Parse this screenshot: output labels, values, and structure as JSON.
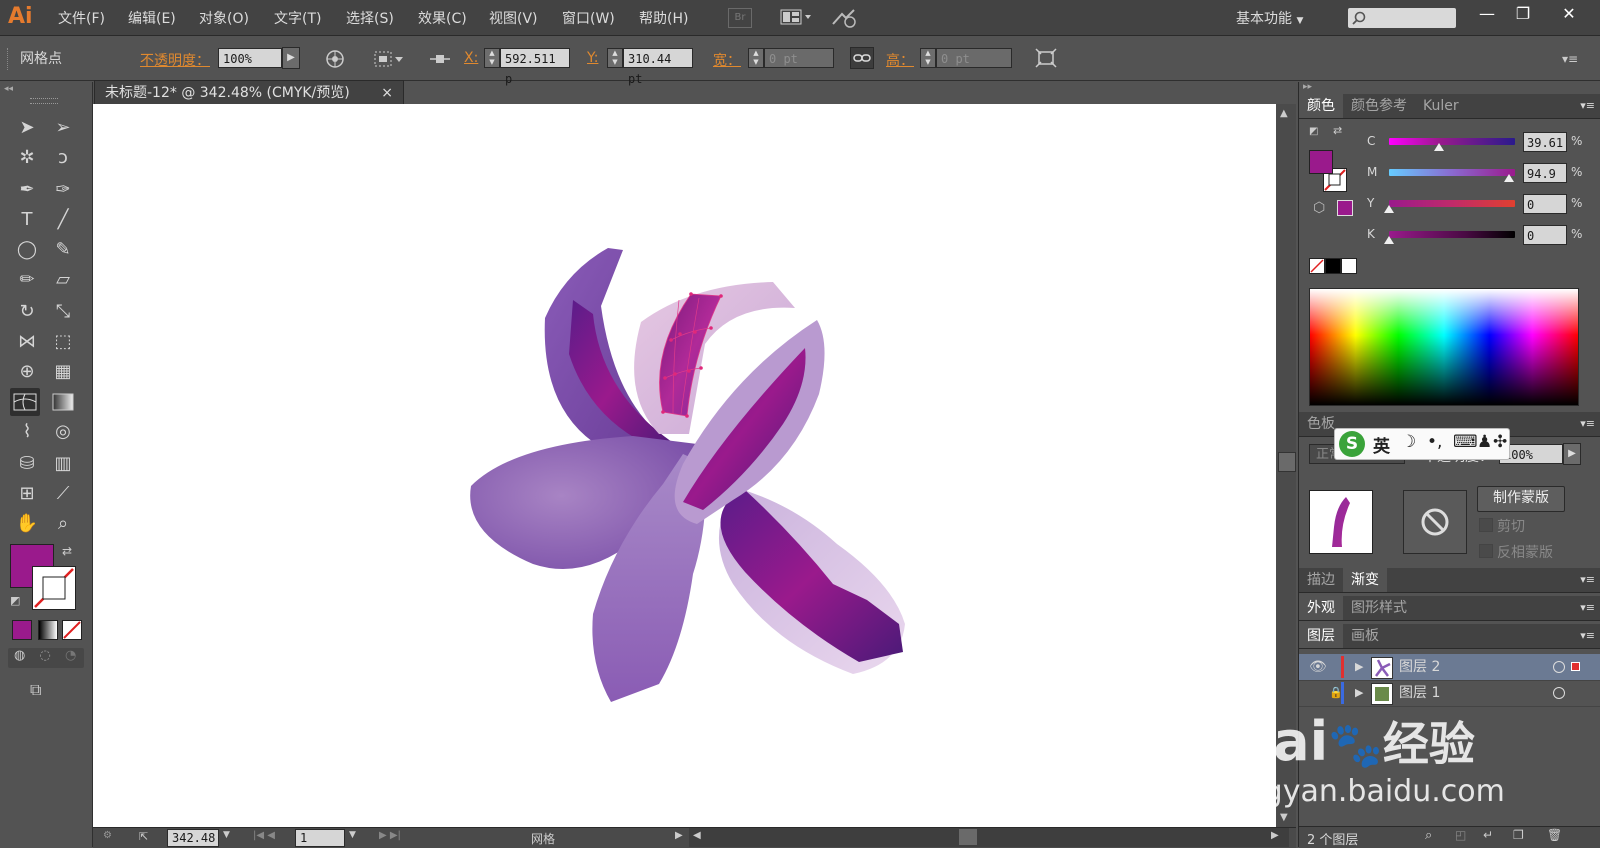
{
  "app": {
    "logo": "Ai"
  },
  "menu": [
    "文件(F)",
    "编辑(E)",
    "对象(O)",
    "文字(T)",
    "选择(S)",
    "效果(C)",
    "视图(V)",
    "窗口(W)",
    "帮助(H)"
  ],
  "bridge_label": "Br",
  "workspace_label": "基本功能",
  "window_controls": {
    "minimize": "—",
    "restore": "❐",
    "close": "✕"
  },
  "control_bar": {
    "selection_type": "网格点",
    "opacity_label": "不透明度：",
    "opacity_value": "100%",
    "x_label": "X:",
    "x_value": "592.511 p",
    "y_label": "Y:",
    "y_value": "310.44 pt",
    "width_label": "宽：",
    "width_value": "0 pt",
    "height_label": "高：",
    "height_value": "0 pt"
  },
  "document": {
    "tab_title": "未标题-12* @ 342.48% (CMYK/预览)",
    "tab_close": "×"
  },
  "status_bar": {
    "zoom": "342.48",
    "artboard": "1",
    "tool_name": "网格"
  },
  "color_panel": {
    "tabs": [
      "颜色",
      "颜色参考",
      "Kuler"
    ],
    "channels": [
      {
        "label": "C",
        "value": "39.61",
        "level": 0.396
      },
      {
        "label": "M",
        "value": "94.9",
        "level": 0.949
      },
      {
        "label": "Y",
        "value": "0",
        "level": 0
      },
      {
        "label": "K",
        "value": "0",
        "level": 0
      }
    ],
    "unit": "%",
    "fill_color": "#9a1a8c"
  },
  "transparency_panel": {
    "tabs_partial": "色板",
    "blend_mode": "正常",
    "opacity_label": "不透明度：",
    "opacity_value": "100%",
    "make_mask": "制作蒙版",
    "clip": "剪切",
    "invert_mask": "反相蒙版"
  },
  "ime_bar": {
    "lang": "英"
  },
  "stroke_gradient_tabs": [
    "描边",
    "渐变"
  ],
  "appearance_tabs": [
    "外观",
    "图形样式"
  ],
  "layers_panel": {
    "tabs": [
      "图层",
      "画板"
    ],
    "layers": [
      {
        "name": "图层 2"
      },
      {
        "name": "图层 1"
      }
    ],
    "count": "2 个图层"
  },
  "watermark": {
    "brand": "Bai",
    "brand2": "经验",
    "url": "jingyan.baidu.com"
  }
}
